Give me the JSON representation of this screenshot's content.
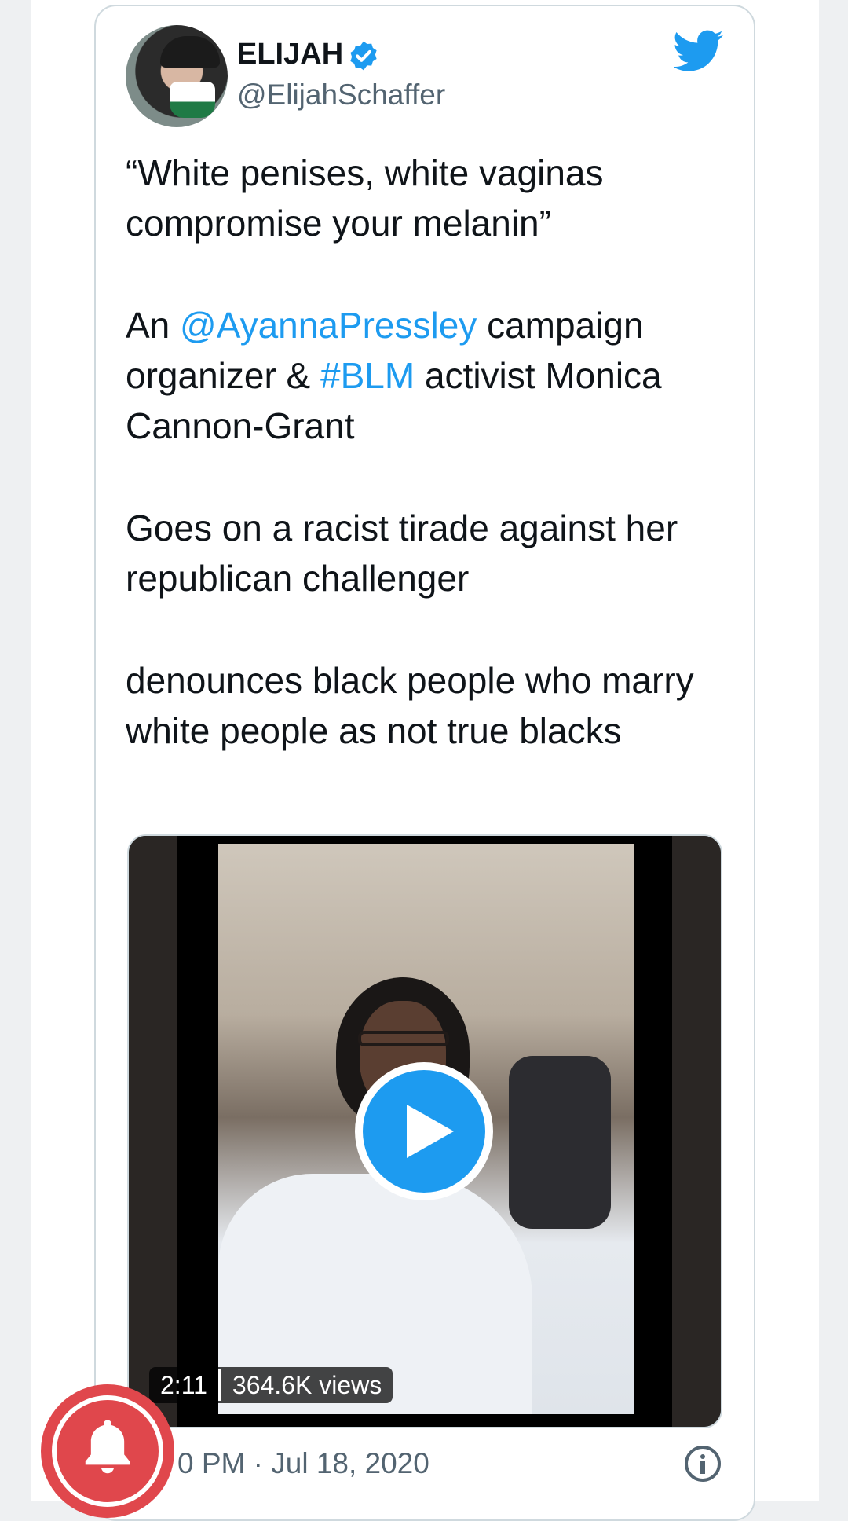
{
  "tweet": {
    "author": {
      "name": "ELIJAH",
      "handle": "@ElijahSchaffer",
      "verified": true
    },
    "paragraphs": [
      {
        "parts": [
          {
            "text": "“White penises, white vaginas compromise your melanin”"
          }
        ]
      },
      {
        "parts": [
          {
            "text": "An "
          },
          {
            "text": "@AyannaPressley",
            "link": true
          },
          {
            "text": " campaign organizer & "
          },
          {
            "text": "#BLM",
            "link": true
          },
          {
            "text": " activist Monica Cannon-Grant"
          }
        ]
      },
      {
        "parts": [
          {
            "text": "Goes on a racist tirade against her republican challenger"
          }
        ]
      },
      {
        "parts": [
          {
            "text": "denounces black people who marry white people as not true blacks"
          }
        ]
      }
    ],
    "video": {
      "duration": "2:11",
      "views": "364.6K views"
    },
    "timestamp": "0 PM · Jul 18, 2020"
  },
  "icons": {
    "brand": "twitter-bird-icon",
    "verified": "verified-badge-icon",
    "play": "play-icon",
    "info": "info-icon",
    "notify": "bell-icon"
  },
  "colors": {
    "accent": "#1d9bf0",
    "text": "#0f1419",
    "secondary": "#536471",
    "notify": "#e0474c"
  }
}
